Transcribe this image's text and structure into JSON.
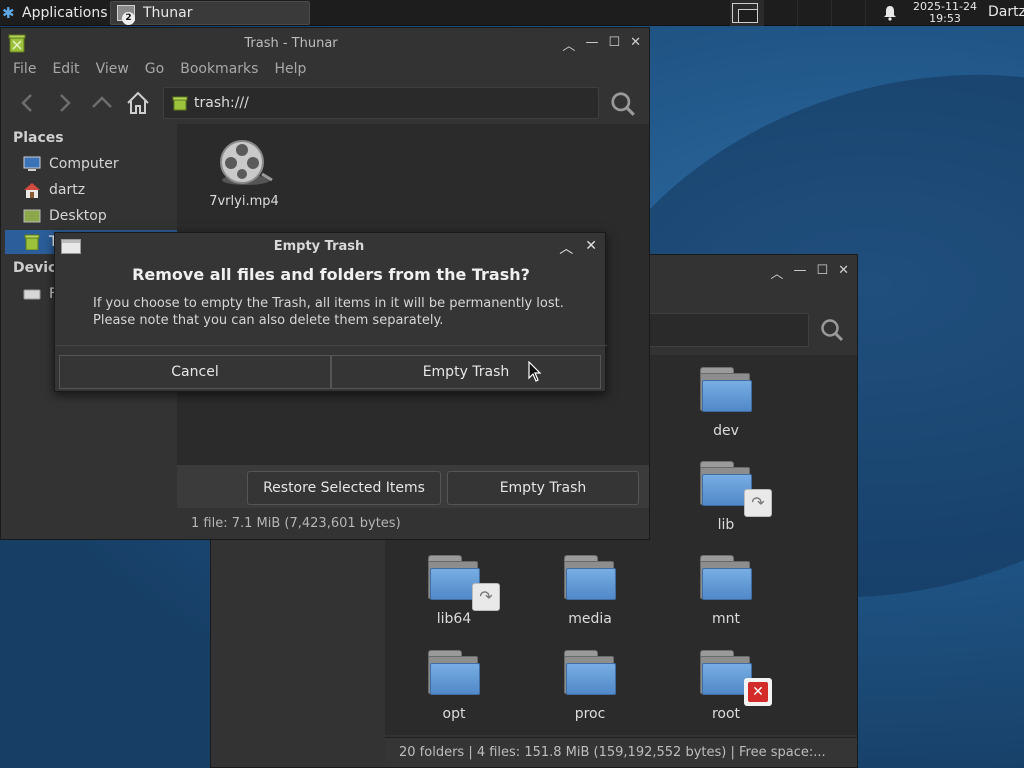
{
  "panel": {
    "applications_label": "Applications",
    "applications_suffix": "∷",
    "task_label": "Thunar",
    "task_badge": "2",
    "clock_date": "2025-11-24",
    "clock_time": "19:53",
    "user": "Dartz"
  },
  "main_window": {
    "title": "Trash - Thunar",
    "menu": [
      "File",
      "Edit",
      "View",
      "Go",
      "Bookmarks",
      "Help"
    ],
    "address": "trash:///",
    "sidebar": {
      "places_header": "Places",
      "devices_header": "Devic",
      "items": [
        {
          "label": "Computer",
          "icon": "computer-icon"
        },
        {
          "label": "dartz",
          "icon": "home-icon"
        },
        {
          "label": "Desktop",
          "icon": "desktop-icon"
        },
        {
          "label": "T",
          "icon": "trash-icon"
        }
      ],
      "device_item": "F"
    },
    "files": [
      {
        "label": "7vrlyi.mp4",
        "icon": "video-file-icon"
      }
    ],
    "restore_button": "Restore Selected Items",
    "empty_button": "Empty Trash",
    "status": "1 file: 7.1 MiB (7,423,601 bytes)"
  },
  "back_window": {
    "folders": [
      {
        "label": "dev",
        "badge": ""
      },
      {
        "label": "lib",
        "badge": "link"
      },
      {
        "label": "lib64",
        "badge": "link"
      },
      {
        "label": "media",
        "badge": ""
      },
      {
        "label": "mnt",
        "badge": ""
      },
      {
        "label": "opt",
        "badge": ""
      },
      {
        "label": "proc",
        "badge": ""
      },
      {
        "label": "root",
        "badge": "locked"
      }
    ],
    "status": "20 folders  |  4 files: 151.8 MiB (159,192,552 bytes)  |  Free space:..."
  },
  "dialog": {
    "title": "Empty Trash",
    "heading": "Remove all files and folders from the Trash?",
    "body_line1": "If you choose to empty the Trash, all items in it will be permanently lost.",
    "body_line2": "Please note that you can also delete them separately.",
    "cancel": "Cancel",
    "confirm": "Empty Trash"
  },
  "colors": {
    "selection": "#2b5e9a",
    "window_bg": "#333333",
    "content_bg": "#2b2b2b",
    "danger": "#d32a2a"
  }
}
